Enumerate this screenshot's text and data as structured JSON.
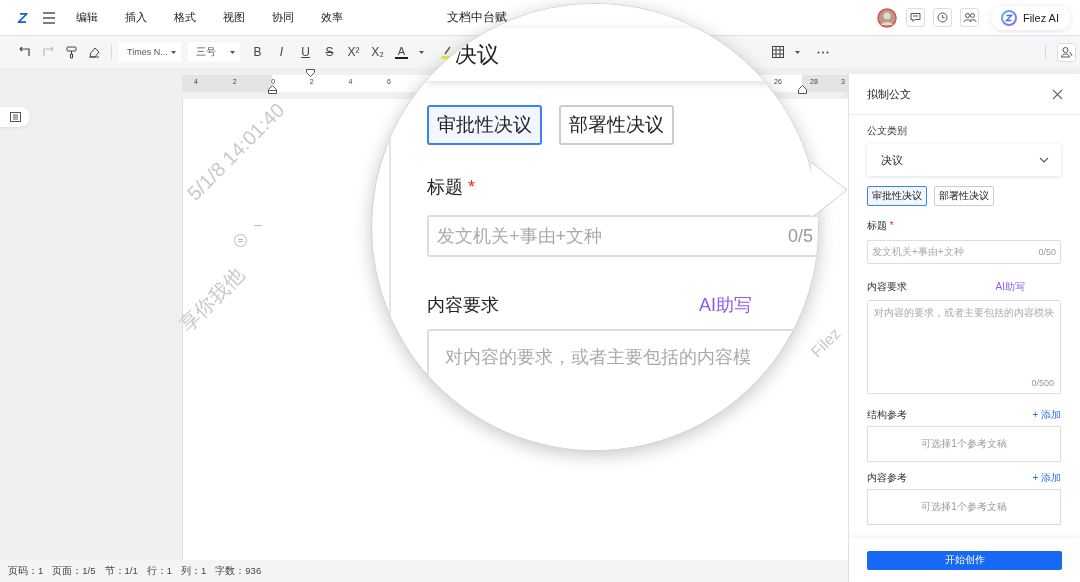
{
  "app": {
    "logo": "Z",
    "menus": [
      "编辑",
      "插入",
      "格式",
      "视图",
      "协同",
      "效率"
    ],
    "doc_title": "文档中台赋",
    "ai_button": "Filez AI"
  },
  "toolbar": {
    "font": "Times N...",
    "size": "三号",
    "format_buttons": [
      "B",
      "I",
      "U",
      "S",
      "X²",
      "X₂"
    ],
    "font_color": "A"
  },
  "ruler": {
    "left_ticks": [
      "4",
      "2",
      "0",
      "2",
      "4",
      "6"
    ],
    "right_ticks": [
      "26",
      "28",
      "3"
    ]
  },
  "watermarks": [
    "5/1/8 14:01:40",
    "享你我他",
    "Filez"
  ],
  "magnifier": {
    "category_value": "决议",
    "subtypes": [
      {
        "label": "审批性决议",
        "selected": true
      },
      {
        "label": "部署性决议",
        "selected": false
      }
    ],
    "title_label": "标题",
    "required_mark": "*",
    "title_placeholder": "发文机关+事由+文种",
    "title_counter": "0/5",
    "content_label": "内容要求",
    "assist": "AI助写",
    "content_placeholder": "对内容的要求，或者主要包括的内容模"
  },
  "panel": {
    "title": "拟制公文",
    "category_label": "公文类别",
    "category_value": "决议",
    "subtypes": [
      {
        "label": "审批性决议",
        "selected": true
      },
      {
        "label": "部署性决议",
        "selected": false
      }
    ],
    "title_label": "标题",
    "required_mark": "*",
    "title_placeholder": "发文机关+事由+文种",
    "title_counter": "0/50",
    "content_label": "内容要求",
    "assist": "AI助写",
    "content_placeholder": "对内容的要求，或者主要包括的内容模块",
    "content_counter": "0/500",
    "references": [
      {
        "label": "结构参考",
        "add": "+ 添加",
        "placeholder": "可选择1个参考文稿"
      },
      {
        "label": "内容参考",
        "add": "+ 添加",
        "placeholder": "可选择1个参考文稿"
      }
    ],
    "submit": "开始创作"
  },
  "status_bar": [
    "页码：1",
    "页面：1/5",
    "节：1/1",
    "行：1",
    "列：1",
    "字数：936"
  ]
}
